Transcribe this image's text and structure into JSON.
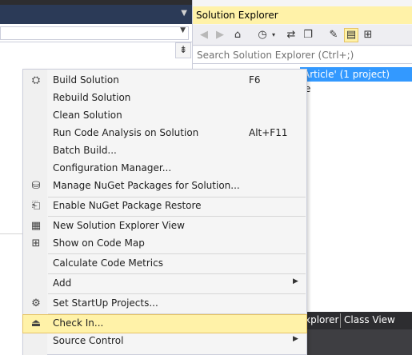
{
  "solution_explorer": {
    "title": "Solution Explorer",
    "search_placeholder": "Search Solution Explorer (Ctrl+;)",
    "tree": {
      "selected_row_visible": "Article' (1 project)",
      "second_row_visible": "e"
    },
    "bottom_tabs": {
      "partial_tab": "xplorer",
      "class_view": "Class View"
    },
    "toolbar_icons": [
      "back-icon",
      "forward-icon",
      "home-icon",
      "history-icon",
      "sync-icon",
      "collapse-all-icon",
      "properties-wrench-icon",
      "show-all-files-icon",
      "code-map-icon"
    ]
  },
  "context_menu": {
    "items": [
      {
        "label": "Build Solution",
        "shortcut": "F6",
        "icon": "build-icon"
      },
      {
        "label": "Rebuild Solution",
        "shortcut": ""
      },
      {
        "label": "Clean Solution",
        "shortcut": ""
      },
      {
        "label": "Run Code Analysis on Solution",
        "shortcut": "Alt+F11"
      },
      {
        "label": "Batch Build...",
        "shortcut": ""
      },
      {
        "label": "Configuration Manager...",
        "shortcut": ""
      },
      {
        "label": "Manage NuGet Packages for Solution...",
        "shortcut": "",
        "icon": "nuget-icon"
      },
      {
        "label": "Enable NuGet Package Restore",
        "shortcut": "",
        "icon": "package-restore-icon"
      },
      {
        "label": "New Solution Explorer View",
        "shortcut": "",
        "icon": "new-view-icon"
      },
      {
        "label": "Show on Code Map",
        "shortcut": "",
        "icon": "code-map-icon"
      },
      {
        "label": "Calculate Code Metrics",
        "shortcut": ""
      },
      {
        "label": "Add",
        "shortcut": "",
        "submenu": true
      },
      {
        "label": "Set StartUp Projects...",
        "shortcut": "",
        "icon": "gear-icon"
      },
      {
        "label": "Check In...",
        "shortcut": "",
        "icon": "check-in-icon",
        "highlighted": true
      },
      {
        "label": "Source Control",
        "shortcut": "",
        "submenu": true
      }
    ]
  },
  "colors": {
    "selection_blue": "#3399ff",
    "highlight_yellow": "#fff2a8",
    "dark_chrome": "#2d2d30"
  }
}
